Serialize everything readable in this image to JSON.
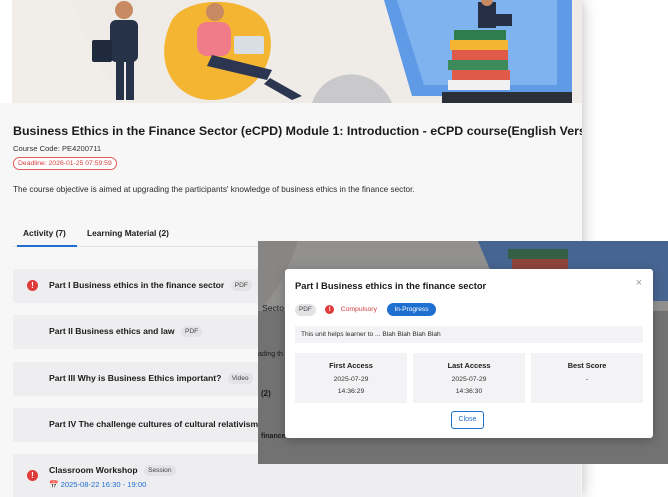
{
  "course": {
    "title": "Business Ethics in the Finance Sector (eCPD) Module 1: Introduction - eCPD course(English Version)",
    "code": "Course Code: PE4200711",
    "deadline": "Deadline: 2026-01-25 07:59:59",
    "objective": "The course objective is aimed at upgrading the participants' knowledge of business ethics in the finance sector."
  },
  "tabs": [
    {
      "label": "Activity (7)"
    },
    {
      "label": "Learning Material (2)"
    }
  ],
  "activities": [
    {
      "title": "Part I Business ethics in the finance sector",
      "tag": "PDF",
      "compulsory_icon": "!"
    },
    {
      "title": "Part II Business ethics and law",
      "tag": "PDF"
    },
    {
      "title": "Part III Why is Business Ethics important?",
      "tag": "Video"
    },
    {
      "title": "Part IV The challenge cultures of cultural relativism",
      "tag": ""
    },
    {
      "title": "Classroom Workshop",
      "tag": "Session",
      "compulsory_icon": "!",
      "date": "2025-08-22  16:30 - 19:00"
    }
  ],
  "overlay_fragments": {
    "a": "Secto",
    "b": "ading th",
    "c": "(2)",
    "d": "finance sector"
  },
  "modal": {
    "title": "Part I Business ethics in the finance sector",
    "close_icon": "×",
    "type_tag": "PDF",
    "compulsory_icon": "!",
    "compulsory_label": "Compulsory",
    "status": "In-Progress",
    "description": "This unit helps learner to ... Blah Blah Blah Blah",
    "stats": [
      {
        "label": "First Access",
        "date": "2025-07-29",
        "time": "14:36:29"
      },
      {
        "label": "Last Access",
        "date": "2025-07-29",
        "time": "14:36:30"
      },
      {
        "label": "Best Score",
        "date": "-",
        "time": ""
      }
    ],
    "close_button": "Close"
  },
  "colors": {
    "accent": "#1f6fd1",
    "danger": "#e03b3b",
    "banner_yellow": "#f4b533",
    "banner_pink": "#f07c8a",
    "banner_blue": "#4a8fe0"
  }
}
